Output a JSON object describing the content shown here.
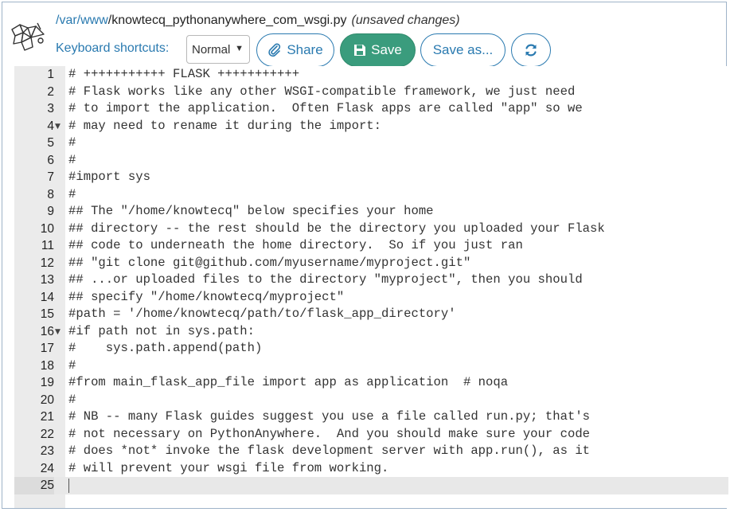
{
  "header": {
    "path_prefix": "/var/",
    "path_link": "www",
    "path_file": "/knowtecq_pythonanywhere_com_wsgi.py",
    "unsaved": "(unsaved changes)",
    "logo_icon": "pythonanywhere-logo-icon"
  },
  "toolbar": {
    "keyboard_label": "Keyboard shortcuts:",
    "keyboard_mode": "Normal",
    "share_label": "Share",
    "save_label": "Save",
    "save_as_label": "Save as...",
    "share_icon": "paperclip-icon",
    "save_icon": "floppy-disk-icon",
    "reload_icon": "refresh-icon",
    "colors": {
      "accent": "#2a7ab0",
      "save_bg": "#3a9c7d"
    }
  },
  "editor": {
    "lines": [
      {
        "num": "1",
        "text": "# +++++++++++ FLASK +++++++++++"
      },
      {
        "num": "2",
        "text": "# Flask works like any other WSGI-compatible framework, we just need"
      },
      {
        "num": "3",
        "text": "# to import the application.  Often Flask apps are called \"app\" so we"
      },
      {
        "num": "4",
        "text": "# may need to rename it during the import:"
      },
      {
        "num": "5",
        "text": "#"
      },
      {
        "num": "6",
        "text": "#"
      },
      {
        "num": "7",
        "text": "#import sys"
      },
      {
        "num": "8",
        "text": "#"
      },
      {
        "num": "9",
        "text": "## The \"/home/knowtecq\" below specifies your home"
      },
      {
        "num": "10",
        "text": "## directory -- the rest should be the directory you uploaded your Flask"
      },
      {
        "num": "11",
        "text": "## code to underneath the home directory.  So if you just ran"
      },
      {
        "num": "12",
        "text": "## \"git clone git@github.com/myusername/myproject.git\""
      },
      {
        "num": "13",
        "text": "## ...or uploaded files to the directory \"myproject\", then you should"
      },
      {
        "num": "14",
        "text": "## specify \"/home/knowtecq/myproject\""
      },
      {
        "num": "15",
        "text": "#path = '/home/knowtecq/path/to/flask_app_directory'"
      },
      {
        "num": "16",
        "text": "#if path not in sys.path:"
      },
      {
        "num": "17",
        "text": "#    sys.path.append(path)"
      },
      {
        "num": "18",
        "text": "#"
      },
      {
        "num": "19",
        "text": "#from main_flask_app_file import app as application  # noqa"
      },
      {
        "num": "20",
        "text": "#"
      },
      {
        "num": "21",
        "text": "# NB -- many Flask guides suggest you use a file called run.py; that's"
      },
      {
        "num": "22",
        "text": "# not necessary on PythonAnywhere.  And you should make sure your code"
      },
      {
        "num": "23",
        "text": "# does *not* invoke the flask development server with app.run(), as it"
      },
      {
        "num": "24",
        "text": "# will prevent your wsgi file from working."
      },
      {
        "num": "25",
        "text": ""
      }
    ]
  }
}
